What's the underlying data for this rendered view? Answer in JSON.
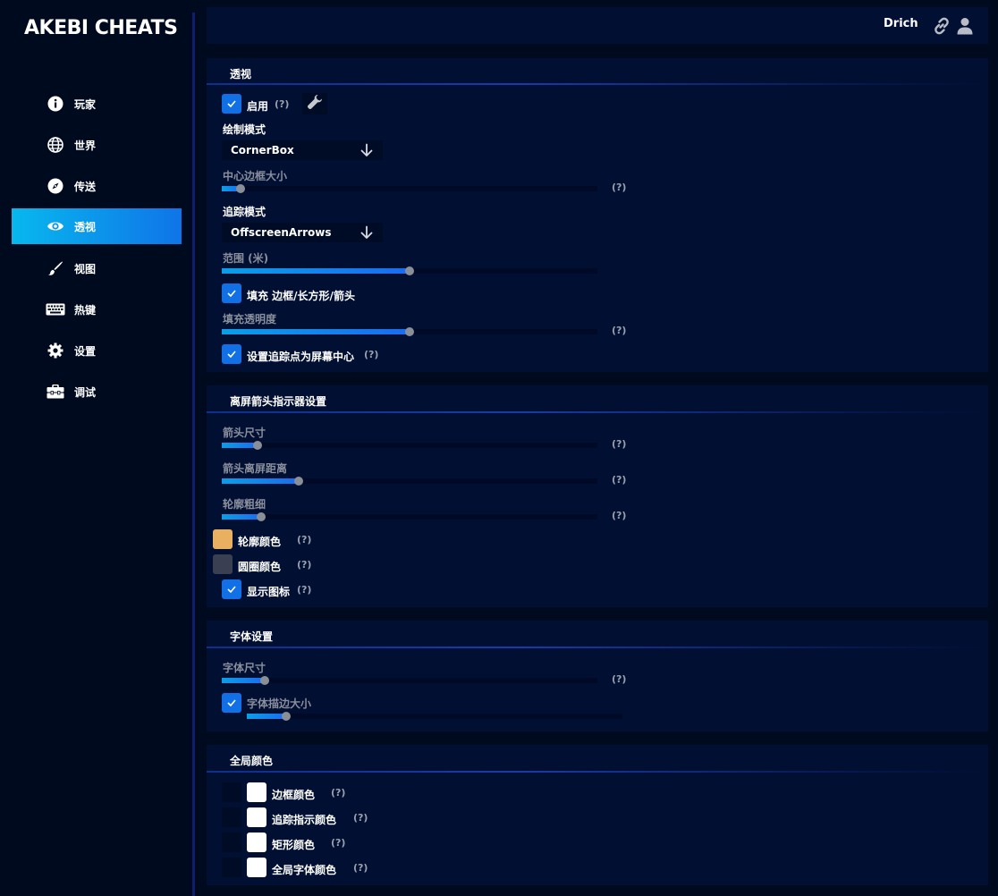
{
  "app": {
    "title": "AKEBI CHEATS"
  },
  "sidebar": {
    "items": [
      {
        "label": "玩家",
        "icon": "info-icon"
      },
      {
        "label": "世界",
        "icon": "globe-icon"
      },
      {
        "label": "传送",
        "icon": "compass-icon"
      },
      {
        "label": "透视",
        "icon": "eye-icon",
        "active": true
      },
      {
        "label": "视图",
        "icon": "brush-icon"
      },
      {
        "label": "热键",
        "icon": "keyboard-icon"
      },
      {
        "label": "设置",
        "icon": "gear-icon"
      },
      {
        "label": "调试",
        "icon": "toolbox-icon"
      }
    ]
  },
  "header": {
    "user": "Drich",
    "icons": [
      "link-icon",
      "user-icon"
    ]
  },
  "help_text": "(?)",
  "esp": {
    "title": "透视",
    "enable": {
      "label": "启用",
      "checked": true
    },
    "draw_mode": {
      "label": "绘制模式",
      "value": "CornerBox"
    },
    "center_box_size": {
      "label": "中心边框大小",
      "value": 0.05
    },
    "tracer_mode": {
      "label": "追踪模式",
      "value": "OffscreenArrows"
    },
    "range": {
      "label": "范围 (米)",
      "value": 0.5
    },
    "fill": {
      "label": "填充 边框/长方形/箭头",
      "checked": true
    },
    "fill_opacity": {
      "label": "填充透明度",
      "value": 0.5
    },
    "tracer_center": {
      "label": "设置追踪点为屏幕中心",
      "checked": true
    }
  },
  "arrows": {
    "title": "离屏箭头指示器设置",
    "arrow_size": {
      "label": "箭头尺寸",
      "value": 0.095
    },
    "arrow_distance": {
      "label": "箭头离屏距离",
      "value": 0.205
    },
    "outline_thickness": {
      "label": "轮廓粗细",
      "value": 0.105
    },
    "outline_color": {
      "label": "轮廓颜色",
      "color": "#e8b060"
    },
    "circle_color": {
      "label": "圆圈颜色",
      "color": "#3a3f52"
    },
    "show_icon": {
      "label": "显示图标",
      "checked": true
    }
  },
  "font": {
    "title": "字体设置",
    "font_size": {
      "label": "字体尺寸",
      "value": 0.115
    },
    "outline_size": {
      "label": "字体描边大小",
      "checked": true,
      "value": 0.105
    }
  },
  "global_colors": {
    "title": "全局颜色",
    "items": [
      {
        "label": "边框颜色",
        "color": "#ffffff"
      },
      {
        "label": "追踪指示颜色",
        "color": "#ffffff"
      },
      {
        "label": "矩形颜色",
        "color": "#ffffff"
      },
      {
        "label": "全局字体颜色",
        "color": "#ffffff"
      }
    ]
  }
}
